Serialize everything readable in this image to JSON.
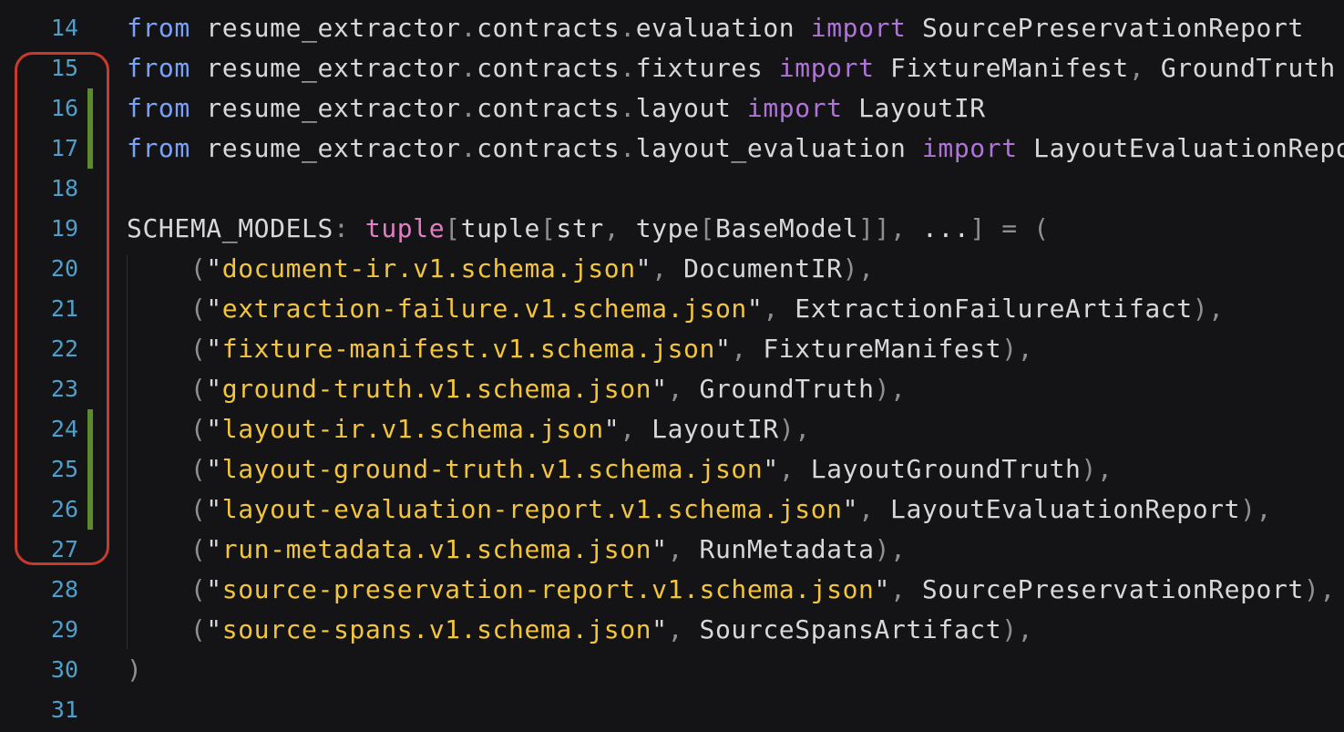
{
  "editor": {
    "lines": [
      {
        "num": "14",
        "changed": false,
        "tokens": [
          {
            "t": "from",
            "c": "kw"
          },
          {
            "t": " resume_extractor",
            "c": "name"
          },
          {
            "t": ".",
            "c": "dot"
          },
          {
            "t": "contracts",
            "c": "name"
          },
          {
            "t": ".",
            "c": "dot"
          },
          {
            "t": "evaluation ",
            "c": "name"
          },
          {
            "t": "import",
            "c": "imp"
          },
          {
            "t": " SourcePreservationReport",
            "c": "name"
          }
        ]
      },
      {
        "num": "15",
        "changed": false,
        "tokens": [
          {
            "t": "from",
            "c": "kw"
          },
          {
            "t": " resume_extractor",
            "c": "name"
          },
          {
            "t": ".",
            "c": "dot"
          },
          {
            "t": "contracts",
            "c": "name"
          },
          {
            "t": ".",
            "c": "dot"
          },
          {
            "t": "fixtures ",
            "c": "name"
          },
          {
            "t": "import",
            "c": "imp"
          },
          {
            "t": " FixtureManifest",
            "c": "name"
          },
          {
            "t": ",",
            "c": "punc"
          },
          {
            "t": " GroundTruth",
            "c": "name"
          }
        ]
      },
      {
        "num": "16",
        "changed": true,
        "tokens": [
          {
            "t": "from",
            "c": "kw"
          },
          {
            "t": " resume_extractor",
            "c": "name"
          },
          {
            "t": ".",
            "c": "dot"
          },
          {
            "t": "contracts",
            "c": "name"
          },
          {
            "t": ".",
            "c": "dot"
          },
          {
            "t": "layout ",
            "c": "name"
          },
          {
            "t": "import",
            "c": "imp"
          },
          {
            "t": " LayoutIR",
            "c": "name"
          }
        ]
      },
      {
        "num": "17",
        "changed": true,
        "tokens": [
          {
            "t": "from",
            "c": "kw"
          },
          {
            "t": " resume_extractor",
            "c": "name"
          },
          {
            "t": ".",
            "c": "dot"
          },
          {
            "t": "contracts",
            "c": "name"
          },
          {
            "t": ".",
            "c": "dot"
          },
          {
            "t": "layout_evaluation ",
            "c": "name"
          },
          {
            "t": "import",
            "c": "imp"
          },
          {
            "t": " LayoutEvaluationRepo",
            "c": "name"
          }
        ]
      },
      {
        "num": "18",
        "changed": false,
        "tokens": []
      },
      {
        "num": "19",
        "changed": false,
        "tokens": [
          {
            "t": "SCHEMA_MODELS",
            "c": "name"
          },
          {
            "t": ": ",
            "c": "punc"
          },
          {
            "t": "tuple",
            "c": "type"
          },
          {
            "t": "[",
            "c": "punc"
          },
          {
            "t": "tuple",
            "c": "name"
          },
          {
            "t": "[",
            "c": "punc"
          },
          {
            "t": "str",
            "c": "name"
          },
          {
            "t": ", ",
            "c": "punc"
          },
          {
            "t": "type",
            "c": "name"
          },
          {
            "t": "[",
            "c": "punc"
          },
          {
            "t": "BaseModel",
            "c": "name"
          },
          {
            "t": "]], ",
            "c": "punc"
          },
          {
            "t": "...",
            "c": "name"
          },
          {
            "t": "] = (",
            "c": "punc"
          }
        ]
      },
      {
        "num": "20",
        "changed": false,
        "tokens": [
          {
            "t": "    (",
            "c": "punc"
          },
          {
            "t": "\"",
            "c": "q"
          },
          {
            "t": "document-ir.v1.schema.json",
            "c": "str"
          },
          {
            "t": "\"",
            "c": "q"
          },
          {
            "t": ", ",
            "c": "punc"
          },
          {
            "t": "DocumentIR",
            "c": "name"
          },
          {
            "t": "),",
            "c": "punc"
          }
        ]
      },
      {
        "num": "21",
        "changed": false,
        "tokens": [
          {
            "t": "    (",
            "c": "punc"
          },
          {
            "t": "\"",
            "c": "q"
          },
          {
            "t": "extraction-failure.v1.schema.json",
            "c": "str"
          },
          {
            "t": "\"",
            "c": "q"
          },
          {
            "t": ", ",
            "c": "punc"
          },
          {
            "t": "ExtractionFailureArtifact",
            "c": "name"
          },
          {
            "t": "),",
            "c": "punc"
          }
        ]
      },
      {
        "num": "22",
        "changed": false,
        "tokens": [
          {
            "t": "    (",
            "c": "punc"
          },
          {
            "t": "\"",
            "c": "q"
          },
          {
            "t": "fixture-manifest.v1.schema.json",
            "c": "str"
          },
          {
            "t": "\"",
            "c": "q"
          },
          {
            "t": ", ",
            "c": "punc"
          },
          {
            "t": "FixtureManifest",
            "c": "name"
          },
          {
            "t": "),",
            "c": "punc"
          }
        ]
      },
      {
        "num": "23",
        "changed": false,
        "tokens": [
          {
            "t": "    (",
            "c": "punc"
          },
          {
            "t": "\"",
            "c": "q"
          },
          {
            "t": "ground-truth.v1.schema.json",
            "c": "str"
          },
          {
            "t": "\"",
            "c": "q"
          },
          {
            "t": ", ",
            "c": "punc"
          },
          {
            "t": "GroundTruth",
            "c": "name"
          },
          {
            "t": "),",
            "c": "punc"
          }
        ]
      },
      {
        "num": "24",
        "changed": true,
        "tokens": [
          {
            "t": "    (",
            "c": "punc"
          },
          {
            "t": "\"",
            "c": "q"
          },
          {
            "t": "layout-ir.v1.schema.json",
            "c": "str"
          },
          {
            "t": "\"",
            "c": "q"
          },
          {
            "t": ", ",
            "c": "punc"
          },
          {
            "t": "LayoutIR",
            "c": "name"
          },
          {
            "t": "),",
            "c": "punc"
          }
        ]
      },
      {
        "num": "25",
        "changed": true,
        "tokens": [
          {
            "t": "    (",
            "c": "punc"
          },
          {
            "t": "\"",
            "c": "q"
          },
          {
            "t": "layout-ground-truth.v1.schema.json",
            "c": "str"
          },
          {
            "t": "\"",
            "c": "q"
          },
          {
            "t": ", ",
            "c": "punc"
          },
          {
            "t": "LayoutGroundTruth",
            "c": "name"
          },
          {
            "t": "),",
            "c": "punc"
          }
        ]
      },
      {
        "num": "26",
        "changed": true,
        "tokens": [
          {
            "t": "    (",
            "c": "punc"
          },
          {
            "t": "\"",
            "c": "q"
          },
          {
            "t": "layout-evaluation-report.v1.schema.json",
            "c": "str"
          },
          {
            "t": "\"",
            "c": "q"
          },
          {
            "t": ", ",
            "c": "punc"
          },
          {
            "t": "LayoutEvaluationReport",
            "c": "name"
          },
          {
            "t": "),",
            "c": "punc"
          }
        ]
      },
      {
        "num": "27",
        "changed": false,
        "tokens": [
          {
            "t": "    (",
            "c": "punc"
          },
          {
            "t": "\"",
            "c": "q"
          },
          {
            "t": "run-metadata.v1.schema.json",
            "c": "str"
          },
          {
            "t": "\"",
            "c": "q"
          },
          {
            "t": ", ",
            "c": "punc"
          },
          {
            "t": "RunMetadata",
            "c": "name"
          },
          {
            "t": "),",
            "c": "punc"
          }
        ]
      },
      {
        "num": "28",
        "changed": false,
        "tokens": [
          {
            "t": "    (",
            "c": "punc"
          },
          {
            "t": "\"",
            "c": "q"
          },
          {
            "t": "source-preservation-report.v1.schema.json",
            "c": "str"
          },
          {
            "t": "\"",
            "c": "q"
          },
          {
            "t": ", ",
            "c": "punc"
          },
          {
            "t": "SourcePreservationReport",
            "c": "name"
          },
          {
            "t": "),",
            "c": "punc"
          }
        ]
      },
      {
        "num": "29",
        "changed": false,
        "tokens": [
          {
            "t": "    (",
            "c": "punc"
          },
          {
            "t": "\"",
            "c": "q"
          },
          {
            "t": "source-spans.v1.schema.json",
            "c": "str"
          },
          {
            "t": "\"",
            "c": "q"
          },
          {
            "t": ", ",
            "c": "punc"
          },
          {
            "t": "SourceSpansArtifact",
            "c": "name"
          },
          {
            "t": "),",
            "c": "punc"
          }
        ]
      },
      {
        "num": "30",
        "changed": false,
        "tokens": [
          {
            "t": ")",
            "c": "punc"
          }
        ]
      },
      {
        "num": "31",
        "changed": false,
        "tokens": []
      }
    ]
  },
  "colors": {
    "background": "#141417",
    "line_number": "#4f9fca",
    "change_bar": "#5d8b2c",
    "highlight_box": "#c63b2b",
    "keyword": "#7aa2f7",
    "import": "#b073d8",
    "string": "#f2c53d",
    "type": "#e17fc2"
  }
}
